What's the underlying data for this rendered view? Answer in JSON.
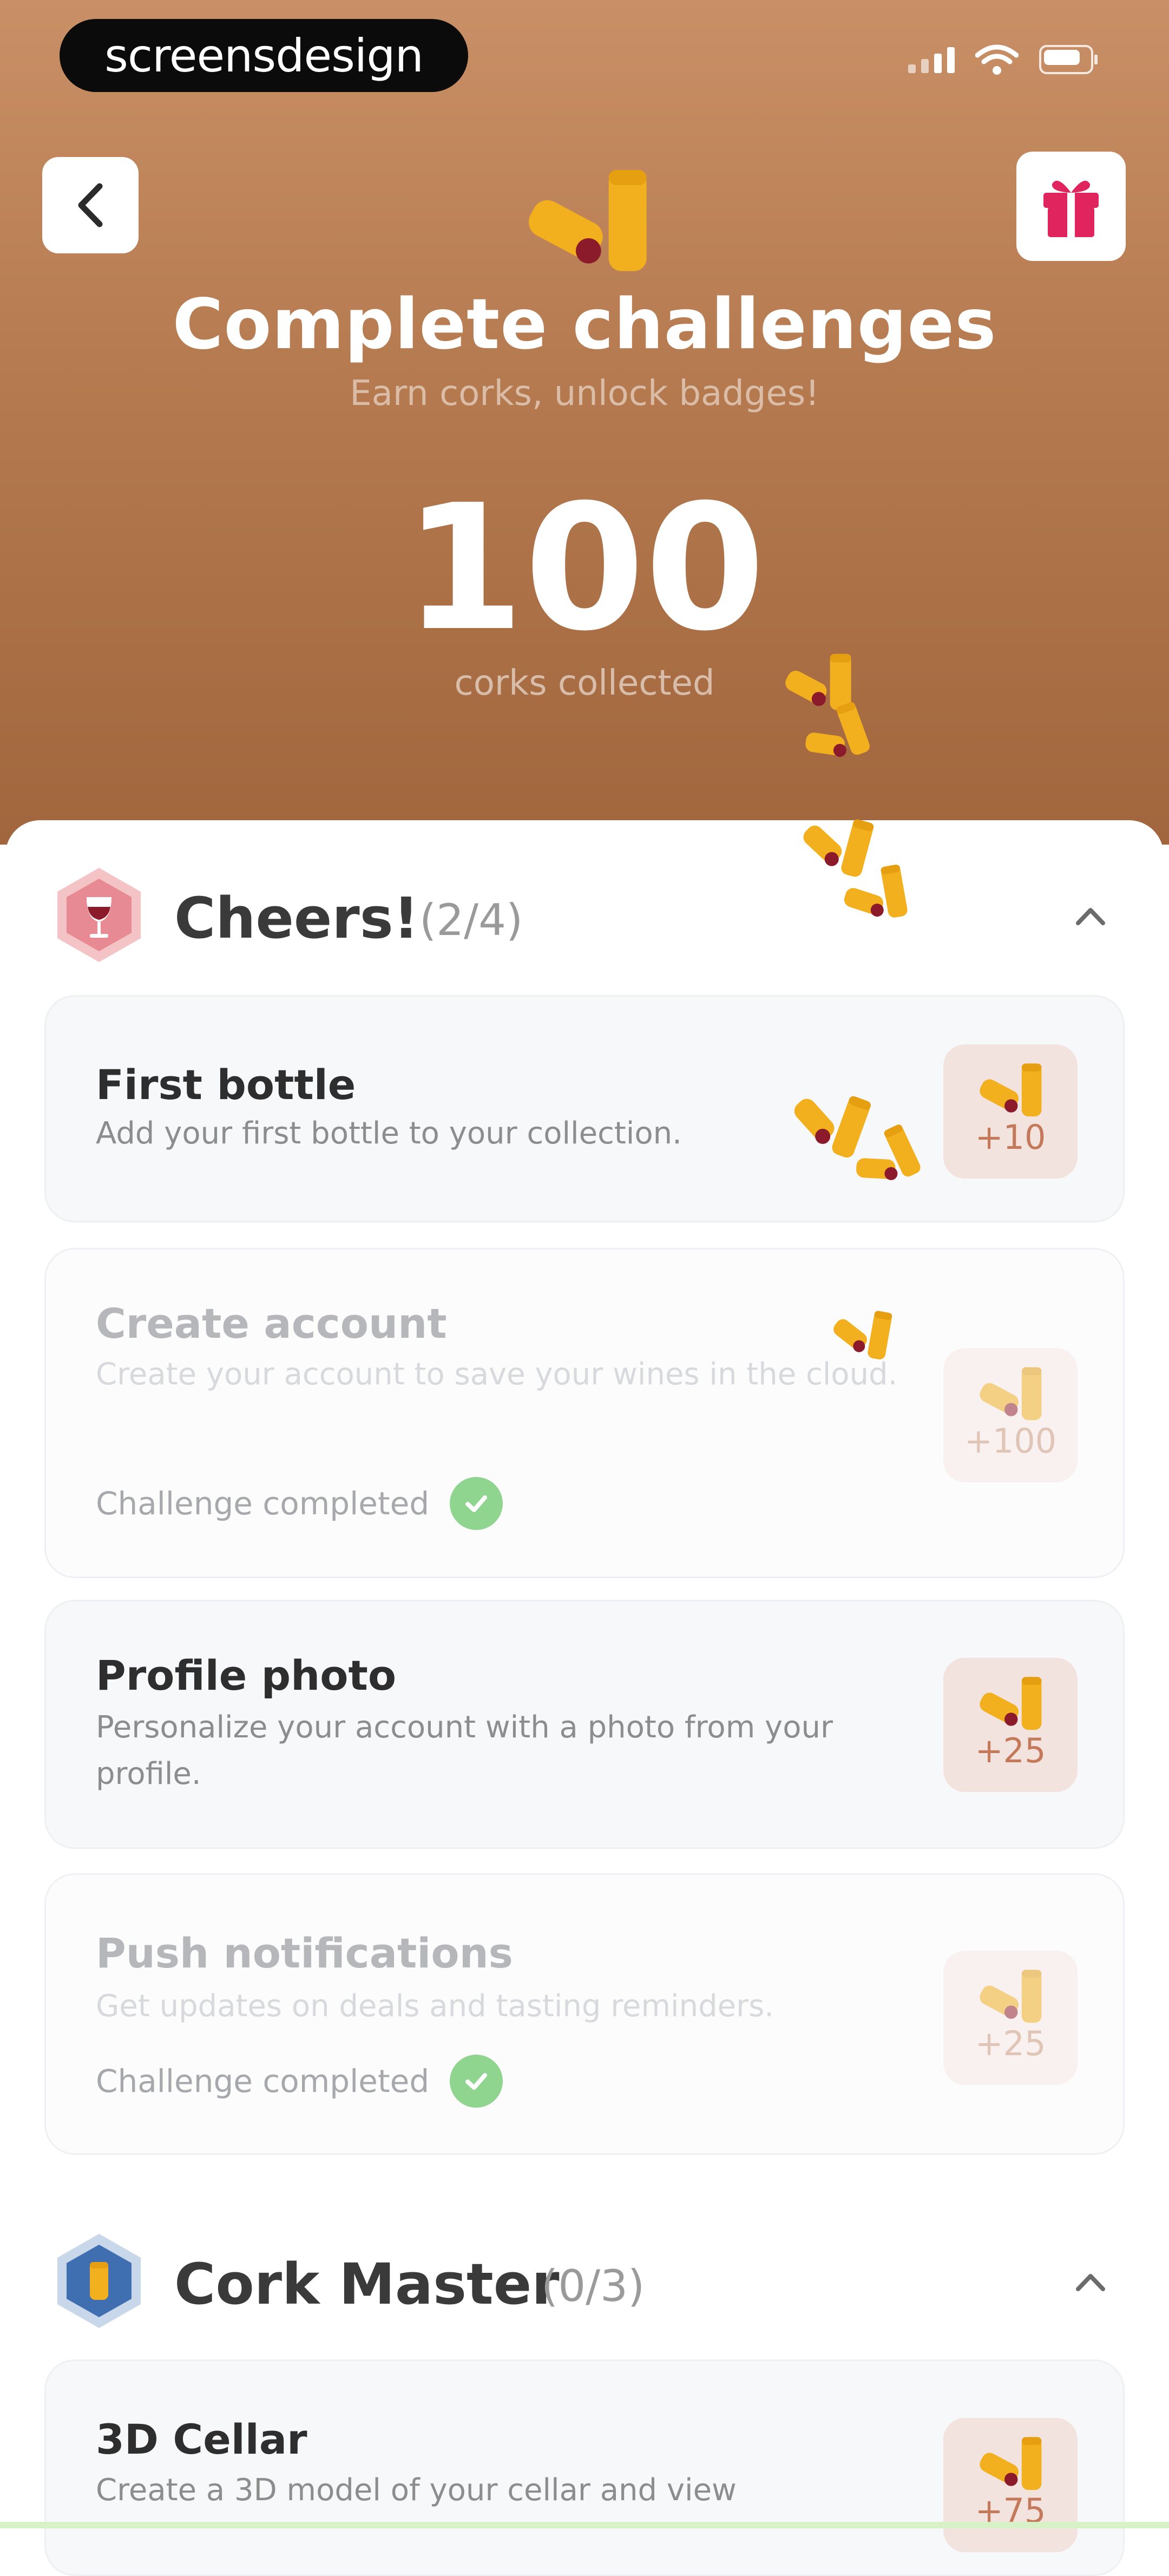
{
  "status_bar": {
    "brand": "screensdesign"
  },
  "header": {
    "title": "Complete challenges",
    "subtitle": "Earn corks, unlock badges!",
    "cork_count": "100",
    "cork_count_label": "corks collected"
  },
  "sections": [
    {
      "name": "Cheers!",
      "progress": "(2/4)",
      "badge_color": "#e88a93",
      "challenges": [
        {
          "title": "First bottle",
          "desc": "Add your first bottle to your collection.",
          "reward": "+10",
          "completed": false
        },
        {
          "title": "Create account",
          "desc": "Create your account to save your wines in the cloud.",
          "reward": "+100",
          "completed": true,
          "status": "Challenge completed"
        },
        {
          "title": "Profile photo",
          "desc": "Personalize your account with a photo from your profile.",
          "reward": "+25",
          "completed": false
        },
        {
          "title": "Push notifications",
          "desc": "Get updates on deals and tasting reminders.",
          "reward": "+25",
          "completed": true,
          "status": "Challenge completed"
        }
      ]
    },
    {
      "name": "Cork Master",
      "progress": "(0/3)",
      "badge_color": "#3f6fb0",
      "challenges": [
        {
          "title": "3D Cellar",
          "desc": "Create a 3D model of your cellar and view",
          "reward": "+75",
          "completed": false
        }
      ]
    }
  ],
  "colors": {
    "header_top": "#c98f66",
    "header_bottom": "#a1663d",
    "accent_gift": "#e0245e",
    "cork": "#f2b01e",
    "cork_tip": "#8b1a2b"
  },
  "icons": {
    "back": "chevron-left-icon",
    "gift": "gift-icon",
    "collapse": "chevron-up-icon",
    "check": "check-icon",
    "cork": "cork-icon"
  }
}
